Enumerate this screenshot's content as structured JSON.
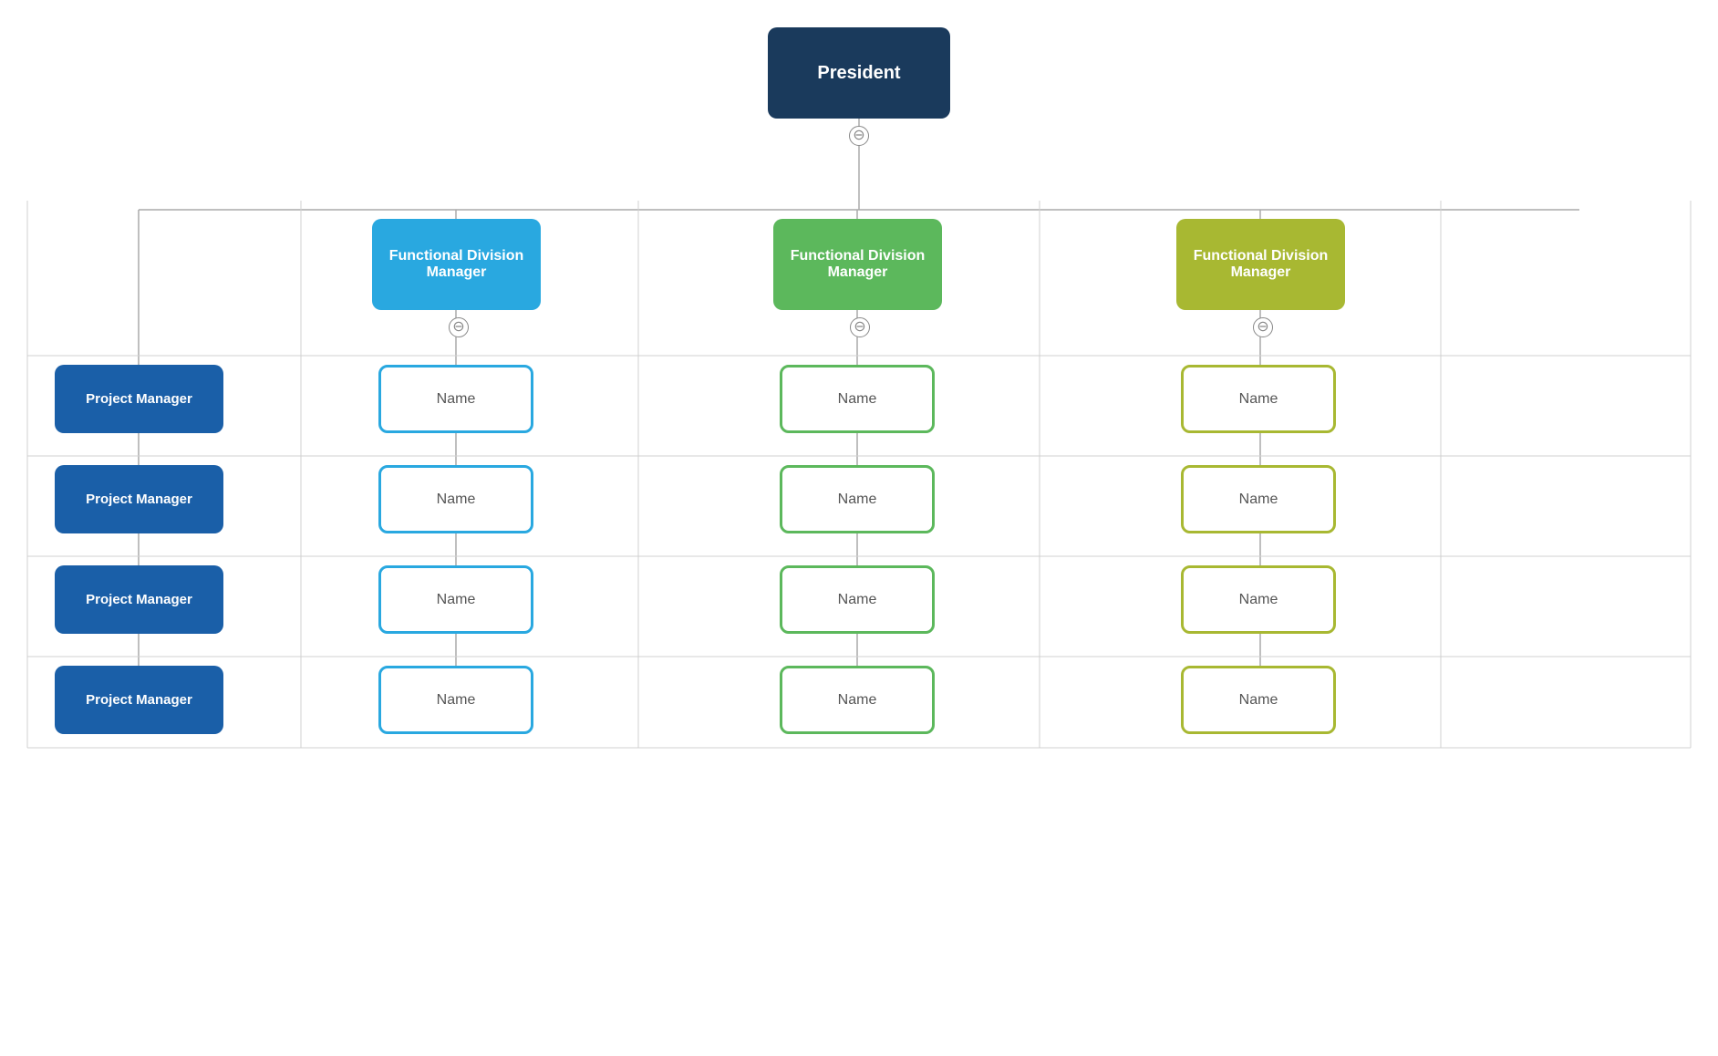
{
  "president": {
    "label": "President"
  },
  "fdm_blue": {
    "label": "Functional Division Manager"
  },
  "fdm_green": {
    "label": "Functional Division Manager"
  },
  "fdm_lime": {
    "label": "Functional Division Manager"
  },
  "project_managers": [
    {
      "label": "Project Manager"
    },
    {
      "label": "Project Manager"
    },
    {
      "label": "Project Manager"
    },
    {
      "label": "Project Manager"
    }
  ],
  "name_nodes": {
    "label": "Name"
  },
  "collapse_btn": {
    "label": "⊖"
  },
  "colors": {
    "president_bg": "#1a3a5c",
    "fdm_blue_bg": "#29a8e0",
    "fdm_green_bg": "#5cb85c",
    "fdm_lime_bg": "#a8b832",
    "pm_bg": "#1a5fa8",
    "name_blue_border": "#29a8e0",
    "name_green_border": "#5cb85c",
    "name_lime_border": "#a8b832"
  }
}
